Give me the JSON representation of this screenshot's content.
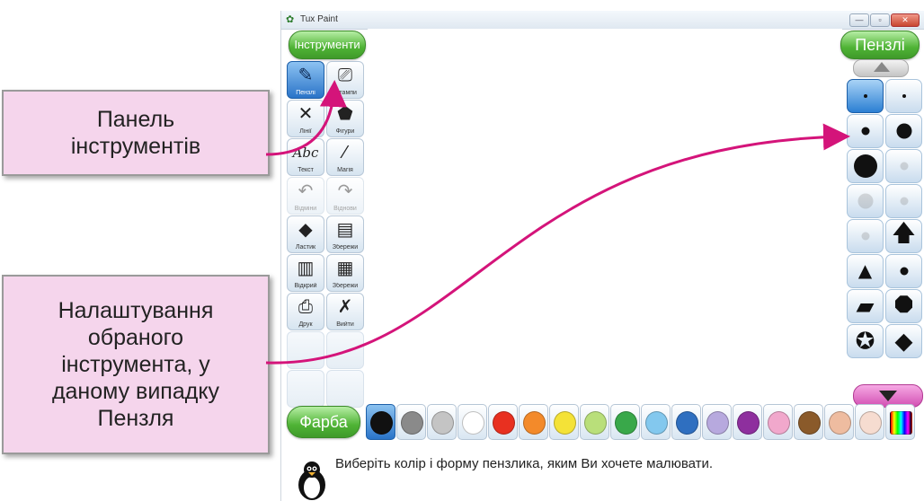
{
  "window": {
    "title": "Tux Paint",
    "controls": [
      "—",
      "▫",
      "✕"
    ]
  },
  "tools_panel": {
    "title": "Інструменти",
    "tools": [
      {
        "label": "Пензлі",
        "icon": "brush-icon",
        "glyph": "✎",
        "state": "selected"
      },
      {
        "label": "Штампи",
        "icon": "stamp-icon",
        "glyph": "⎚",
        "state": "normal"
      },
      {
        "label": "Лінії",
        "icon": "lines-icon",
        "glyph": "✕",
        "state": "normal"
      },
      {
        "label": "Фігури",
        "icon": "shapes-icon",
        "glyph": "⬟",
        "state": "normal"
      },
      {
        "label": "Текст",
        "icon": "text-icon",
        "glyph": "Abc",
        "state": "normal"
      },
      {
        "label": "Магія",
        "icon": "magic-wand-icon",
        "glyph": "⁄",
        "state": "normal"
      },
      {
        "label": "Відміни",
        "icon": "undo-icon",
        "glyph": "↶",
        "state": "faded"
      },
      {
        "label": "Віднови",
        "icon": "redo-icon",
        "glyph": "↷",
        "state": "faded"
      },
      {
        "label": "Ластик",
        "icon": "eraser-icon",
        "glyph": "◆",
        "state": "normal"
      },
      {
        "label": "Збережи",
        "icon": "new-page-icon",
        "glyph": "▤",
        "state": "normal"
      },
      {
        "label": "Відкрий",
        "icon": "open-icon",
        "glyph": "▥",
        "state": "normal"
      },
      {
        "label": "Збережи",
        "icon": "save-icon",
        "glyph": "▦",
        "state": "normal"
      },
      {
        "label": "Друк",
        "icon": "print-icon",
        "glyph": "⎙",
        "state": "normal"
      },
      {
        "label": "Вийти",
        "icon": "quit-icon",
        "glyph": "✗",
        "state": "normal"
      },
      {
        "label": "",
        "icon": "empty-slot-icon",
        "glyph": "",
        "state": "empty"
      },
      {
        "label": "",
        "icon": "empty-slot-icon",
        "glyph": "",
        "state": "empty"
      },
      {
        "label": "",
        "icon": "empty-slot-icon",
        "glyph": "",
        "state": "empty"
      },
      {
        "label": "",
        "icon": "empty-slot-icon",
        "glyph": "",
        "state": "empty"
      }
    ]
  },
  "brushes_panel": {
    "title": "Пензлі",
    "brushes": [
      {
        "icon": "tiny-dot-brush-icon",
        "shape": "dot",
        "size": "xs",
        "state": "selected"
      },
      {
        "icon": "tiny-dot-brush-icon",
        "shape": "dot",
        "size": "xs",
        "state": "normal"
      },
      {
        "icon": "small-dot-brush-icon",
        "shape": "dot",
        "size": "s",
        "state": "normal"
      },
      {
        "icon": "medium-dot-brush-icon",
        "shape": "dot",
        "size": "m",
        "state": "normal"
      },
      {
        "icon": "large-dot-brush-icon",
        "shape": "dot",
        "size": "l",
        "state": "normal"
      },
      {
        "icon": "fuzzy-dot-brush-icon",
        "shape": "dot",
        "size": "s",
        "state": "faded"
      },
      {
        "icon": "fuzzy-dot-brush-icon",
        "shape": "dot",
        "size": "m",
        "state": "faded"
      },
      {
        "icon": "fuzzy-dot-brush-icon",
        "shape": "dot",
        "size": "s",
        "state": "faded"
      },
      {
        "icon": "fuzzy-dot-brush-icon",
        "shape": "dot",
        "size": "s",
        "state": "faded"
      },
      {
        "icon": "arrow-up-brush-icon",
        "shape": "glyph",
        "glyph": "🡅",
        "state": "normal"
      },
      {
        "icon": "triangle-brush-icon",
        "shape": "glyph",
        "glyph": "▲",
        "state": "normal"
      },
      {
        "icon": "small-dot-brush-icon",
        "shape": "dot",
        "size": "s",
        "state": "normal"
      },
      {
        "icon": "parallelogram-brush-icon",
        "shape": "glyph",
        "glyph": "▰",
        "state": "normal"
      },
      {
        "icon": "octagon-brush-icon",
        "shape": "glyph",
        "glyph": "⯃",
        "state": "normal"
      },
      {
        "icon": "star-brush-icon",
        "shape": "glyph",
        "glyph": "✪",
        "state": "normal"
      },
      {
        "icon": "diamond-brush-icon",
        "shape": "glyph",
        "glyph": "◆",
        "state": "normal"
      }
    ]
  },
  "colors_panel": {
    "label": "Фарба",
    "colors": [
      {
        "hex": "#111111",
        "state": "selected"
      },
      {
        "hex": "#8a8a8a",
        "state": "normal"
      },
      {
        "hex": "#c4c4c4",
        "state": "normal"
      },
      {
        "hex": "#ffffff",
        "state": "normal"
      },
      {
        "hex": "#e83020",
        "state": "normal"
      },
      {
        "hex": "#f38a2a",
        "state": "normal"
      },
      {
        "hex": "#f4e237",
        "state": "normal"
      },
      {
        "hex": "#b9df7a",
        "state": "normal"
      },
      {
        "hex": "#39a84a",
        "state": "normal"
      },
      {
        "hex": "#83c8ee",
        "state": "normal"
      },
      {
        "hex": "#2f6fc0",
        "state": "normal"
      },
      {
        "hex": "#b7a9de",
        "state": "normal"
      },
      {
        "hex": "#8e2f9e",
        "state": "normal"
      },
      {
        "hex": "#f1a8cc",
        "state": "normal"
      },
      {
        "hex": "#8a5a2a",
        "state": "normal"
      },
      {
        "hex": "#eebca0",
        "state": "normal"
      },
      {
        "hex": "#f6dcd0",
        "state": "normal"
      },
      {
        "hex": "rainbow",
        "state": "normal"
      }
    ]
  },
  "info_bar": {
    "message": "Виберіть колір і форму пензлика, яким Ви хочете малювати."
  },
  "callouts": {
    "toolbar": "Панель\nінструментів",
    "settings": "Налаштування\nобраного\nінструмента, у\nданому випадку\nПензля"
  },
  "colors": {
    "accent_green": "#4fb335",
    "arrow_magenta": "#d4147a",
    "callout_bg": "#f5d5ec"
  }
}
